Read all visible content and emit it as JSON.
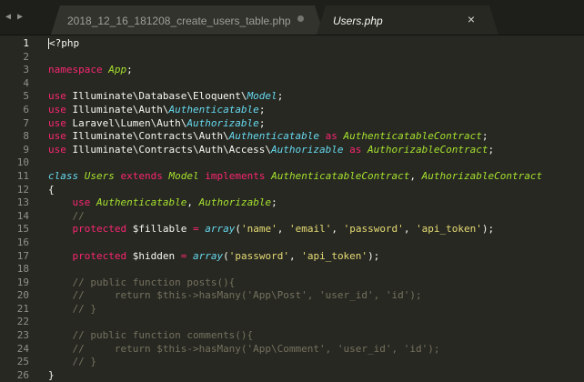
{
  "tabs": [
    {
      "label": "2018_12_16_181208_create_users_table.php",
      "active": false
    },
    {
      "label": "Users.php",
      "active": true
    }
  ],
  "nav": {
    "back": "◀",
    "forward": "▶"
  },
  "close_glyph": "×",
  "colors": {
    "background": "#272822",
    "keyword": "#f92672",
    "class": "#a6e22e",
    "type": "#66d9ef",
    "string": "#e6db74",
    "comment": "#75715e"
  },
  "lines": [
    {
      "n": "1",
      "t": [
        {
          "c": "pl",
          "s": "<?php",
          "cursor": true
        }
      ]
    },
    {
      "n": "2",
      "t": []
    },
    {
      "n": "3",
      "t": [
        {
          "c": "kw",
          "s": "namespace"
        },
        {
          "c": "pl",
          "s": " "
        },
        {
          "c": "cl",
          "s": "App"
        },
        {
          "c": "pl",
          "s": ";"
        }
      ]
    },
    {
      "n": "4",
      "t": []
    },
    {
      "n": "5",
      "t": [
        {
          "c": "kw",
          "s": "use"
        },
        {
          "c": "pl",
          "s": " Illuminate\\Database\\Eloquent\\"
        },
        {
          "c": "tp",
          "s": "Model"
        },
        {
          "c": "pl",
          "s": ";"
        }
      ]
    },
    {
      "n": "6",
      "t": [
        {
          "c": "kw",
          "s": "use"
        },
        {
          "c": "pl",
          "s": " Illuminate\\Auth\\"
        },
        {
          "c": "tp",
          "s": "Authenticatable"
        },
        {
          "c": "pl",
          "s": ";"
        }
      ]
    },
    {
      "n": "7",
      "t": [
        {
          "c": "kw",
          "s": "use"
        },
        {
          "c": "pl",
          "s": " Laravel\\Lumen\\Auth\\"
        },
        {
          "c": "tp",
          "s": "Authorizable"
        },
        {
          "c": "pl",
          "s": ";"
        }
      ]
    },
    {
      "n": "8",
      "t": [
        {
          "c": "kw",
          "s": "use"
        },
        {
          "c": "pl",
          "s": " Illuminate\\Contracts\\Auth\\"
        },
        {
          "c": "tp",
          "s": "Authenticatable"
        },
        {
          "c": "pl",
          "s": " "
        },
        {
          "c": "kw",
          "s": "as"
        },
        {
          "c": "pl",
          "s": " "
        },
        {
          "c": "cl",
          "s": "AuthenticatableContract"
        },
        {
          "c": "pl",
          "s": ";"
        }
      ]
    },
    {
      "n": "9",
      "t": [
        {
          "c": "kw",
          "s": "use"
        },
        {
          "c": "pl",
          "s": " Illuminate\\Contracts\\Auth\\Access\\"
        },
        {
          "c": "tp",
          "s": "Authorizable"
        },
        {
          "c": "pl",
          "s": " "
        },
        {
          "c": "kw",
          "s": "as"
        },
        {
          "c": "pl",
          "s": " "
        },
        {
          "c": "cl",
          "s": "AuthorizableContract"
        },
        {
          "c": "pl",
          "s": ";"
        }
      ]
    },
    {
      "n": "10",
      "t": []
    },
    {
      "n": "11",
      "t": [
        {
          "c": "tp",
          "s": "class"
        },
        {
          "c": "pl",
          "s": " "
        },
        {
          "c": "cl",
          "s": "Users"
        },
        {
          "c": "pl",
          "s": " "
        },
        {
          "c": "kw",
          "s": "extends"
        },
        {
          "c": "pl",
          "s": " "
        },
        {
          "c": "cl",
          "s": "Model"
        },
        {
          "c": "pl",
          "s": " "
        },
        {
          "c": "kw",
          "s": "implements"
        },
        {
          "c": "pl",
          "s": " "
        },
        {
          "c": "cl",
          "s": "AuthenticatableContract"
        },
        {
          "c": "pl",
          "s": ", "
        },
        {
          "c": "cl",
          "s": "AuthorizableContract"
        }
      ]
    },
    {
      "n": "12",
      "t": [
        {
          "c": "pl",
          "s": "{"
        }
      ]
    },
    {
      "n": "13",
      "t": [
        {
          "c": "pl",
          "s": "    "
        },
        {
          "c": "kw",
          "s": "use"
        },
        {
          "c": "pl",
          "s": " "
        },
        {
          "c": "cl",
          "s": "Authenticatable"
        },
        {
          "c": "pl",
          "s": ", "
        },
        {
          "c": "cl",
          "s": "Authorizable"
        },
        {
          "c": "pl",
          "s": ";"
        }
      ]
    },
    {
      "n": "14",
      "t": [
        {
          "c": "pl",
          "s": "    "
        },
        {
          "c": "cm",
          "s": "//"
        }
      ]
    },
    {
      "n": "15",
      "t": [
        {
          "c": "pl",
          "s": "    "
        },
        {
          "c": "kw",
          "s": "protected"
        },
        {
          "c": "pl",
          "s": " $fillable "
        },
        {
          "c": "kw",
          "s": "="
        },
        {
          "c": "pl",
          "s": " "
        },
        {
          "c": "tp",
          "s": "array"
        },
        {
          "c": "pl",
          "s": "("
        },
        {
          "c": "st",
          "s": "'name'"
        },
        {
          "c": "pl",
          "s": ", "
        },
        {
          "c": "st",
          "s": "'email'"
        },
        {
          "c": "pl",
          "s": ", "
        },
        {
          "c": "st",
          "s": "'password'"
        },
        {
          "c": "pl",
          "s": ", "
        },
        {
          "c": "st",
          "s": "'api_token'"
        },
        {
          "c": "pl",
          "s": ");"
        }
      ]
    },
    {
      "n": "16",
      "t": []
    },
    {
      "n": "17",
      "t": [
        {
          "c": "pl",
          "s": "    "
        },
        {
          "c": "kw",
          "s": "protected"
        },
        {
          "c": "pl",
          "s": " $hidden "
        },
        {
          "c": "kw",
          "s": "="
        },
        {
          "c": "pl",
          "s": " "
        },
        {
          "c": "tp",
          "s": "array"
        },
        {
          "c": "pl",
          "s": "("
        },
        {
          "c": "st",
          "s": "'password'"
        },
        {
          "c": "pl",
          "s": ", "
        },
        {
          "c": "st",
          "s": "'api_token'"
        },
        {
          "c": "pl",
          "s": ");"
        }
      ]
    },
    {
      "n": "18",
      "t": []
    },
    {
      "n": "19",
      "t": [
        {
          "c": "pl",
          "s": "    "
        },
        {
          "c": "cm",
          "s": "// public function posts(){"
        }
      ]
    },
    {
      "n": "20",
      "t": [
        {
          "c": "pl",
          "s": "    "
        },
        {
          "c": "cm",
          "s": "//     return $this->hasMany('App\\Post', 'user_id', 'id');"
        }
      ]
    },
    {
      "n": "21",
      "t": [
        {
          "c": "pl",
          "s": "    "
        },
        {
          "c": "cm",
          "s": "// }"
        }
      ]
    },
    {
      "n": "22",
      "t": []
    },
    {
      "n": "23",
      "t": [
        {
          "c": "pl",
          "s": "    "
        },
        {
          "c": "cm",
          "s": "// public function comments(){"
        }
      ]
    },
    {
      "n": "24",
      "t": [
        {
          "c": "pl",
          "s": "    "
        },
        {
          "c": "cm",
          "s": "//     return $this->hasMany('App\\Comment', 'user_id', 'id');"
        }
      ]
    },
    {
      "n": "25",
      "t": [
        {
          "c": "pl",
          "s": "    "
        },
        {
          "c": "cm",
          "s": "// }"
        }
      ]
    },
    {
      "n": "26",
      "t": [
        {
          "c": "pl",
          "s": "}"
        }
      ]
    }
  ]
}
